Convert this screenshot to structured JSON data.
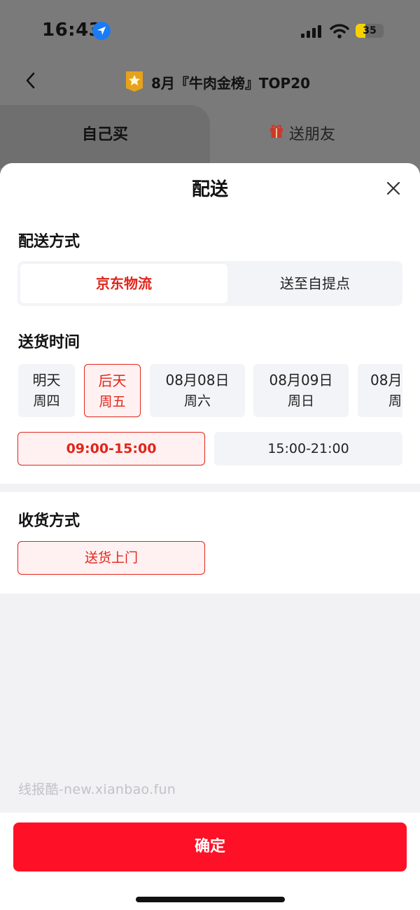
{
  "status_bar": {
    "time": "16:43",
    "battery": "35"
  },
  "header": {
    "title": "8月『牛肉金榜』TOP20"
  },
  "tabs": [
    {
      "label": "自己买"
    },
    {
      "label": "送朋友"
    }
  ],
  "sheet": {
    "title": "配送",
    "delivery_method": {
      "label": "配送方式",
      "options": [
        "京东物流",
        "送至自提点"
      ],
      "selected": "京东物流"
    },
    "delivery_time": {
      "label": "送货时间",
      "dates": [
        {
          "line1": "明天",
          "line2": "周四"
        },
        {
          "line1": "后天",
          "line2": "周五",
          "selected": true
        },
        {
          "line1": "08月08日",
          "line2": "周六"
        },
        {
          "line1": "08月09日",
          "line2": "周日"
        },
        {
          "line1": "08月",
          "line2": "周"
        }
      ],
      "slots": [
        {
          "label": "09:00-15:00",
          "selected": true
        },
        {
          "label": "15:00-21:00"
        }
      ]
    },
    "receive_method": {
      "label": "收货方式",
      "option": "送货上门"
    },
    "watermark": "线报酷-new.xianbao.fun"
  },
  "footer": {
    "confirm_label": "确定"
  },
  "colors": {
    "accent": "#e1251b",
    "confirm": "#fe1127",
    "location": "#1a7cf5",
    "battery": "#f7d200"
  }
}
